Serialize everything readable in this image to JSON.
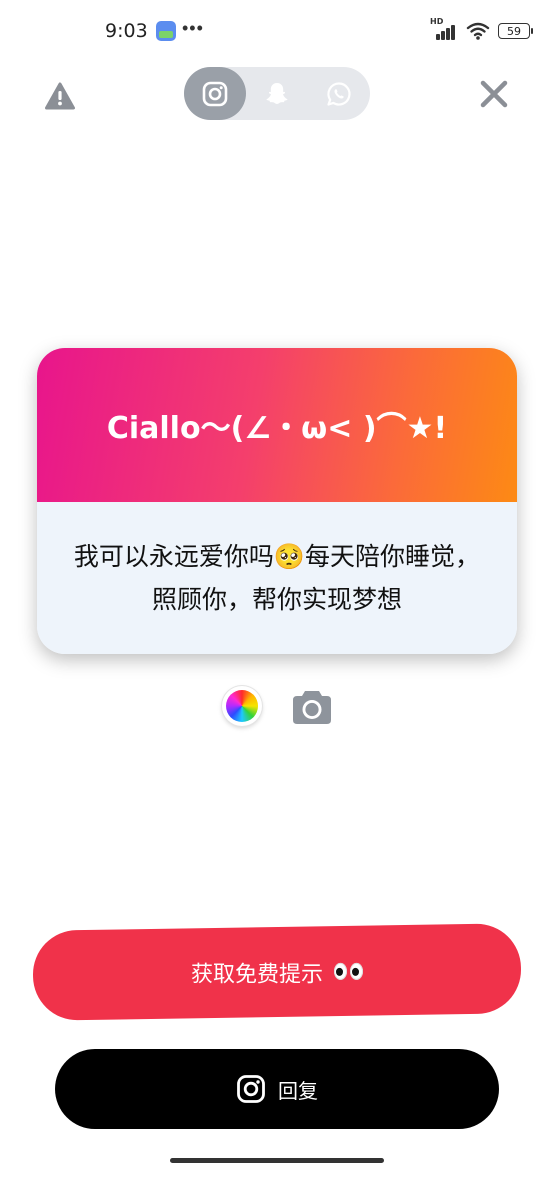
{
  "status_bar": {
    "time": "9:03",
    "dots": "•••",
    "network_label": "HD",
    "battery": "59"
  },
  "top": {
    "warning_icon": "warning-triangle-icon",
    "close_icon": "close-x-icon",
    "platforms": [
      {
        "name": "instagram",
        "icon": "instagram-icon",
        "active": true
      },
      {
        "name": "snapchat",
        "icon": "snapchat-ghost-icon",
        "active": false
      },
      {
        "name": "whatsapp",
        "icon": "whatsapp-icon",
        "active": false
      }
    ]
  },
  "card": {
    "title": "Ciallo～(∠・ω< )⌒★!",
    "message": "我可以永远爱你吗🥺每天陪你睡觉，照顾你，帮你实现梦想",
    "header_gradient": [
      "#e8158c",
      "#fd8a14"
    ],
    "body_color": "#eef4fb"
  },
  "tools": {
    "color_icon": "color-wheel-icon",
    "camera_icon": "camera-icon"
  },
  "buttons": {
    "hint_label": "获取免费提示",
    "hint_emoji": "eyes-emoji-icon",
    "hint_color": "#f0324a",
    "reply_label": "回复",
    "reply_icon": "instagram-icon",
    "reply_color": "#000000"
  }
}
